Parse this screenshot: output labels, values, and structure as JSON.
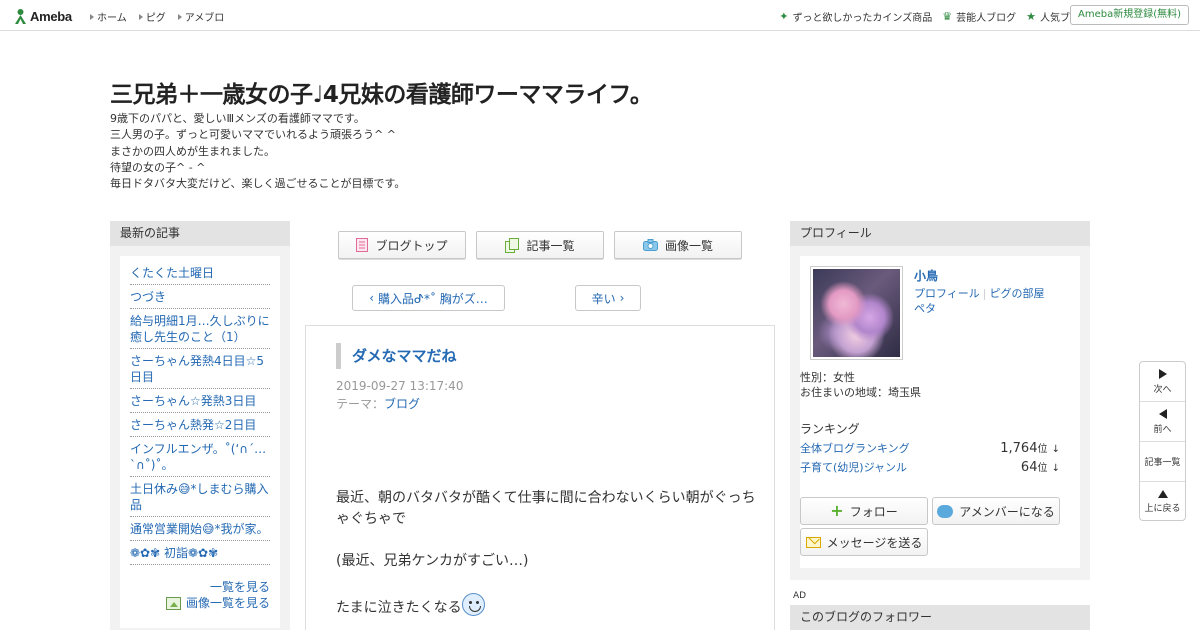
{
  "header": {
    "logo_text": "Ameba",
    "nav": [
      "ホーム",
      "ピグ",
      "アメブロ"
    ],
    "right_links": [
      {
        "icon": "sparkle-icon",
        "label": "ずっと欲しかったカインズ商品"
      },
      {
        "icon": "crown-icon",
        "label": "芸能人ブログ"
      },
      {
        "icon": "star-icon",
        "label": "人気ブログ"
      }
    ],
    "signup_label": "Ameba新規登録(無料)"
  },
  "blog": {
    "title": "三兄弟＋一歳女の子♩4兄妹の看護師ワーママライフ。",
    "description": [
      "9歳下のパパと、愛しいⅢメンズの看護師ママです。",
      "三人男の子。ずっと可愛いママでいれるよう頑張ろう^ ^",
      "まさかの四人めが生まれました。",
      "待望の女の子^ - ^",
      "毎日ドタバタ大変だけど、楽しく過ごせることが目標です。"
    ]
  },
  "sidebar_left": {
    "heading": "最新の記事",
    "entries": [
      "くたくた土曜日",
      "つづき",
      "給与明細1月…久しぶりに癒し先生のこと（1）",
      "さーちゃん発熱4日目☆5日目",
      "さーちゃん☆発熱3日目",
      "さーちゃん熱発☆2日目",
      "インフルエンザ。˚(ʻ∩ˊ…`∩˚)˚。",
      "土日休み😅*しまむら購入品",
      "通常営業開始😅*我が家。",
      "❁✿✾ 初詣❁✿✾"
    ],
    "more_label": "一覧を見る",
    "images_label": "画像一覧を見る"
  },
  "toolbar": {
    "top_label": "ブログトップ",
    "list_label": "記事一覧",
    "images_label": "画像一覧"
  },
  "pager": {
    "prev_label": "購入品ᕷ*˚ 胸がズ…",
    "next_label": "辛い"
  },
  "article": {
    "title": "ダメなママだね",
    "date": "2019-09-27 13:17:40",
    "theme_prefix": "テーマ：",
    "theme": "ブログ",
    "paragraphs": [
      "最近、朝のバタバタが酷くて仕事に間に合わないくらい朝がぐっちゃぐちゃで",
      "(最近、兄弟ケンカがすごい…)",
      "たまに泣きたくなる"
    ]
  },
  "profile": {
    "heading": "プロフィール",
    "name": "小鳥",
    "link_profile": "プロフィール",
    "link_pig": "ピグの部屋",
    "link_peta": "ペタ",
    "gender": "性別：女性",
    "region": "お住まいの地域：埼玉県",
    "ranking_heading": "ランキング",
    "rankings": [
      {
        "label": "全体ブログランキング",
        "value": "1,764",
        "unit": "位",
        "trend": "↓"
      },
      {
        "label": "子育て(幼児)ジャンル",
        "value": "64",
        "unit": "位",
        "trend": "↓"
      }
    ],
    "follow_label": "フォロー",
    "member_label": "アメンバーになる",
    "message_label": "メッセージを送る"
  },
  "ad_label": "AD",
  "followers_heading": "このブログのフォロワー",
  "float_nav": {
    "next": "次へ",
    "prev": "前へ",
    "list": "記事一覧",
    "top": "上に戻る"
  },
  "colors": {
    "brand_green": "#2d8a3f",
    "link_blue": "#2469b3",
    "panel_gray": "#f2f2f2"
  }
}
